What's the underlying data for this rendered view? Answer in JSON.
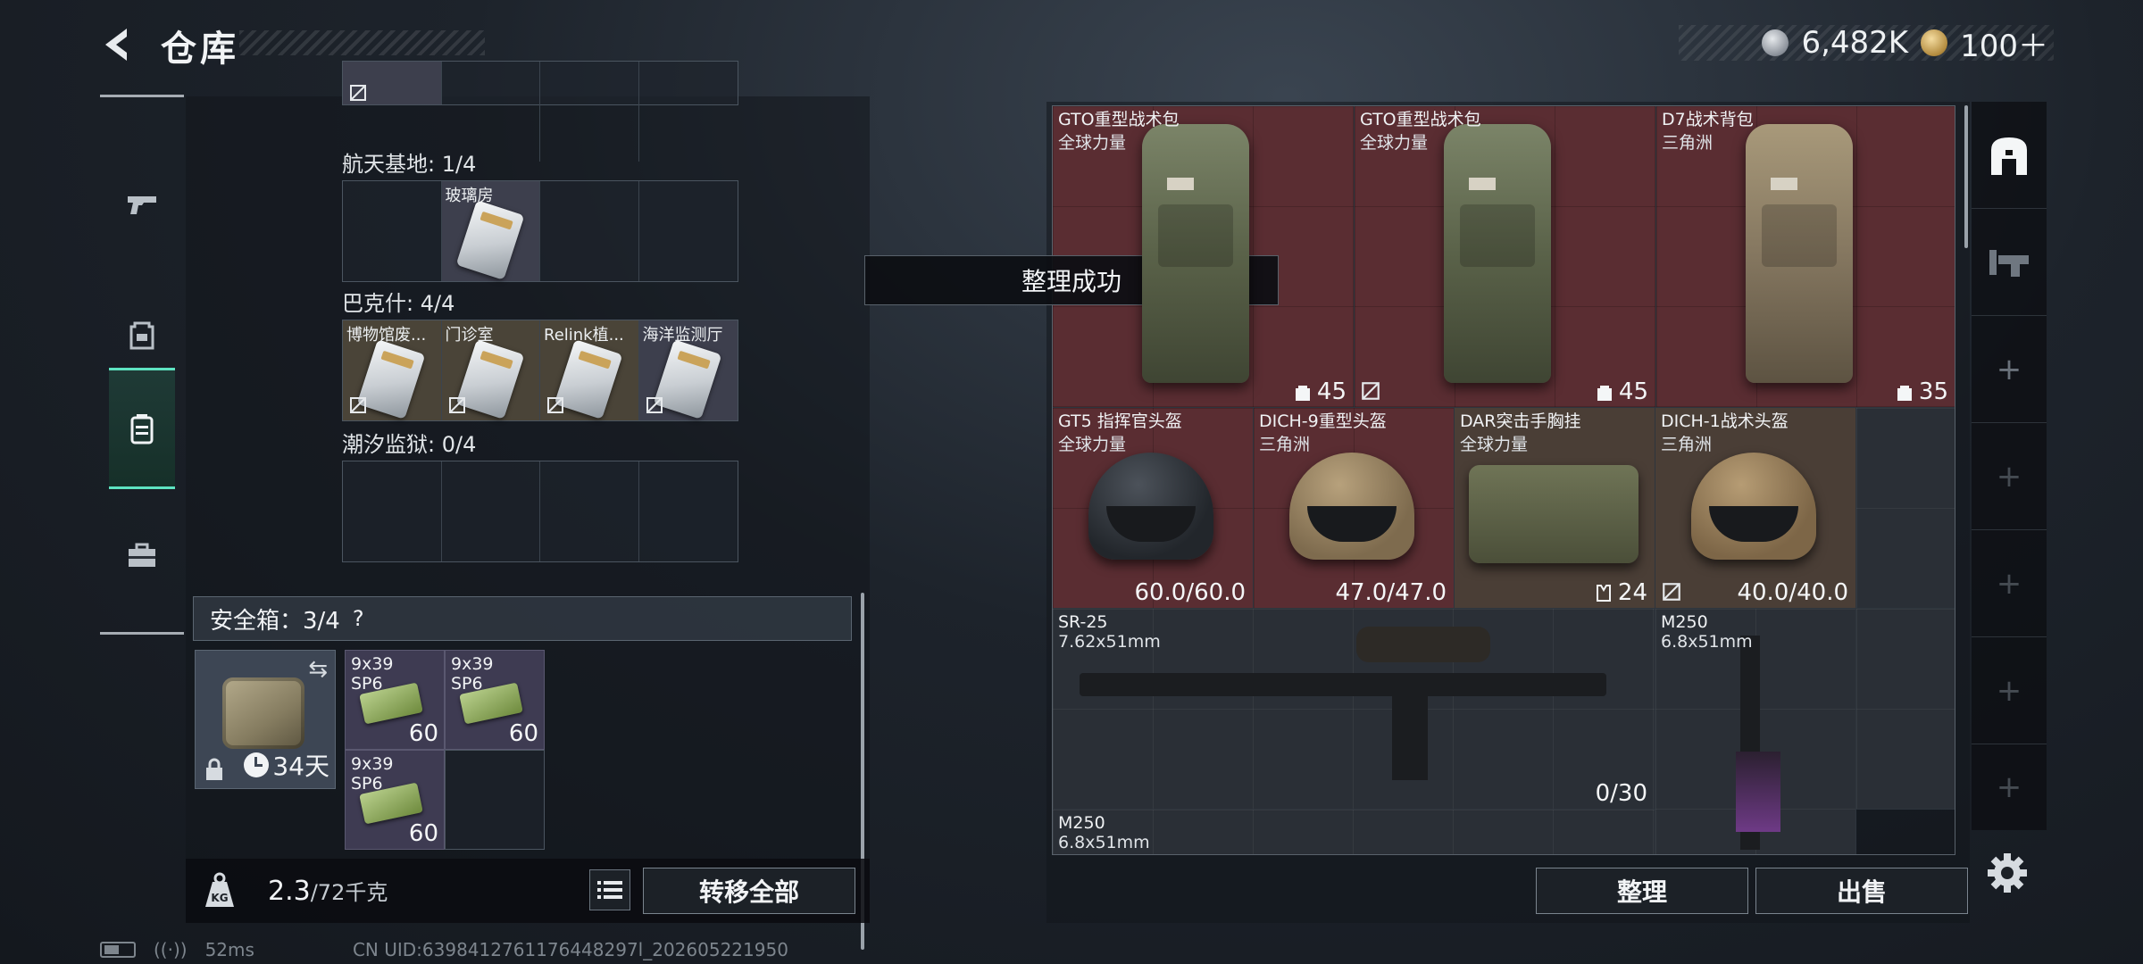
{
  "header": {
    "title": "仓库"
  },
  "currency": [
    {
      "icon": "silver-coin-icon",
      "value": "6,482K"
    },
    {
      "icon": "gold-coin-icon",
      "value": "100＋"
    }
  ],
  "rail": [
    "pistol-icon",
    "backpack-icon",
    "storage-case-icon",
    "toolbox-icon"
  ],
  "left": {
    "locations": [
      {
        "label": "航天基地: 1/4",
        "cells": [
          "",
          "玻璃房",
          "",
          ""
        ]
      },
      {
        "label": "巴克什: 4/4",
        "cells": [
          "博物馆废...",
          "门诊室",
          "Relink植...",
          "海洋监测厅"
        ]
      },
      {
        "label": "潮汐监狱: 0/4",
        "cells": [
          "",
          "",
          "",
          ""
        ]
      }
    ],
    "safe": {
      "label": "安全箱：3/4",
      "help": "?",
      "days": "34天",
      "ammo": [
        {
          "name": "9x39",
          "sub": "SP6",
          "count": "60"
        },
        {
          "name": "9x39",
          "sub": "SP6",
          "count": "60"
        },
        {
          "name": "9x39",
          "sub": "SP6",
          "count": "60"
        }
      ]
    },
    "weight": {
      "value": "2.3",
      "max": "/72千克"
    },
    "transfer_all": "转移全部"
  },
  "toast": "整理成功",
  "inventory": [
    {
      "name": "GTO重型战术包",
      "sub": "全球力量",
      "value": "45",
      "bg": "red"
    },
    {
      "name": "GTO重型战术包",
      "sub": "全球力量",
      "value": "45",
      "bg": "red"
    },
    {
      "name": "D7战术背包",
      "sub": "三角洲",
      "value": "35",
      "bg": "red"
    },
    {
      "name": "GT5 指挥官头盔",
      "sub": "全球力量",
      "value": "60.0/60.0",
      "bg": "red"
    },
    {
      "name": "DICH-9重型头盔",
      "sub": "三角洲",
      "value": "47.0/47.0",
      "bg": "red"
    },
    {
      "name": "DAR突击手胸挂",
      "sub": "全球力量",
      "value": "24",
      "bg": "brown"
    },
    {
      "name": "DICH-1战术头盔",
      "sub": "三角洲",
      "value": "40.0/40.0",
      "bg": "brown"
    },
    {
      "name": "SR-25",
      "sub": "7.62x51mm",
      "value": "0/30",
      "bg": "dark"
    },
    {
      "name": "M250",
      "sub": "6.8x51mm",
      "value": "",
      "bg": "dark"
    },
    {
      "name": "M250",
      "sub": "6.8x51mm",
      "value": "",
      "bg": "dark"
    }
  ],
  "actions": {
    "sort": "整理",
    "sell": "出售"
  },
  "status": {
    "ping": "52ms",
    "uid": "CN UID:6398412761176448297l_202605221950"
  },
  "colors": {
    "accent": "#5ee3c1",
    "red_tile": "#5a2d32",
    "brown_tile": "#4a3e36"
  }
}
